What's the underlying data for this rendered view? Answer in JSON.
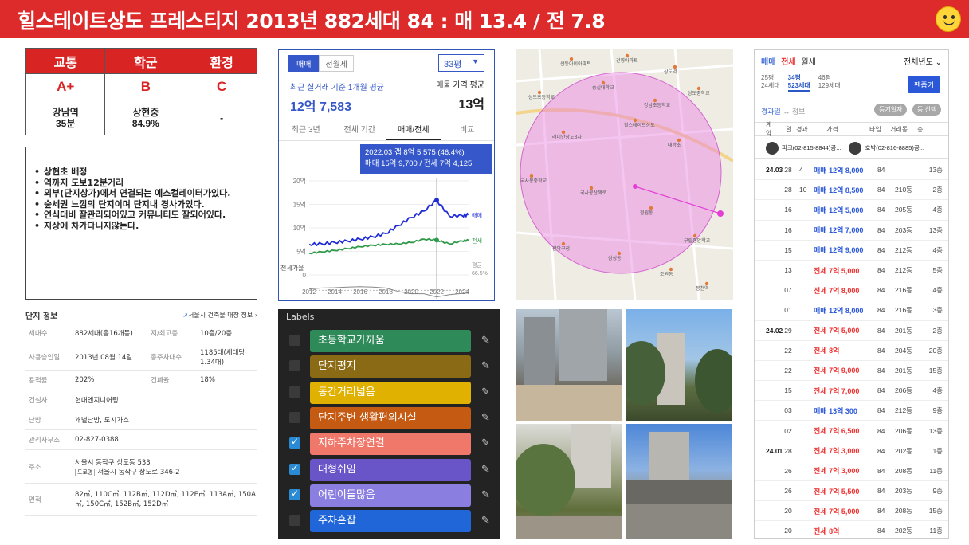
{
  "header": {
    "title": "힐스테이트상도 프레스티지  2013년 882세대  84 : 매 13.4 / 전 7.8",
    "background_color": "#dd2a2a",
    "icon": "smiley-face-icon"
  },
  "grades": {
    "headers": [
      "교통",
      "학군",
      "환경"
    ],
    "grades": [
      "A+",
      "B",
      "C"
    ],
    "details": [
      "강남역\n35분",
      "상현중\n84.9%",
      "-"
    ]
  },
  "notes": [
    "상현초 배정",
    "역까지 도보12분거리",
    "외부(단지상가)에서  연결되는 에스컬레이터가있다.",
    "숲세권 느낌의 단지이며 단지내 경사가있다.",
    "연식대비 잘관리되어있고 커뮤니티도 잘되어있다.",
    "지상에 차가다니지않는다."
  ],
  "complex_info": {
    "title": "단지 정보",
    "link": "서울시 건축물 대장 정보",
    "rows": [
      {
        "label": "세대수",
        "value": "882세대(총16개동)",
        "label2": "저/최고층",
        "value2": "10층/20층"
      },
      {
        "label": "사용승인일",
        "value": "2013년 08월 14일",
        "label2": "총주차대수",
        "value2": "1185대(세대당 1.34대)"
      },
      {
        "label": "용적률",
        "value": "202%",
        "label2": "건폐율",
        "value2": "18%"
      },
      {
        "label": "건설사",
        "value": "현대엔지니어링"
      },
      {
        "label": "난방",
        "value": "개별난방, 도시가스"
      },
      {
        "label": "관리사무소",
        "value": "02-827-0388"
      },
      {
        "label": "주소",
        "value": "서울시 동작구 상도동 533",
        "road_tag": "도로명",
        "road": "서울시 동작구 상도로 346-2"
      },
      {
        "label": "면적",
        "value": "82㎡, 110C㎡, 112B㎡, 112D㎡, 112E㎡, 113A㎡, 150A㎡, 150C㎡, 152B㎡, 152D㎡"
      }
    ]
  },
  "price_card": {
    "tab_sale": "매매",
    "tab_lease": "전월세",
    "size_select": "33평",
    "avg_label": "최근 실거래 기준 1개월 평균",
    "avg_value": "12억 7,583",
    "ask_label": "매물 가격 평균",
    "ask_value": "13억",
    "period_tabs": [
      "최근 3년",
      "전체 기간",
      "매매/전세",
      "비교"
    ],
    "tooltip_line1": "2022.03  갭 8억 5,575 (46.4%)",
    "tooltip_line2": "매매 15억 9,700 / 전세 7억 4,125",
    "lease_ratio_label": "전세가율",
    "avg_ratio_label": "평균",
    "avg_ratio_value": "66.5%",
    "series_sale": "매매",
    "series_lease": "전세"
  },
  "chart_data": {
    "type": "line",
    "x": [
      2012,
      2013,
      2014,
      2015,
      2016,
      2017,
      2018,
      2019,
      2020,
      2021,
      2022,
      2023,
      2024,
      2024.5
    ],
    "xticks": [
      "2012",
      "2014",
      "2016",
      "2018",
      "2020",
      "2022",
      "2024"
    ],
    "yticks": [
      "0",
      "5억",
      "10억",
      "15억",
      "20억"
    ],
    "ylim": [
      0,
      20
    ],
    "series": [
      {
        "name": "매매",
        "color": "#1f2bd6",
        "values": [
          6.5,
          6.6,
          6.9,
          7.2,
          7.6,
          8.1,
          8.8,
          10.5,
          12.2,
          13.6,
          15.9,
          12.5,
          12.6,
          12.8
        ]
      },
      {
        "name": "전세",
        "color": "#2e9a4a",
        "values": [
          4.6,
          4.9,
          5.2,
          5.6,
          6.0,
          6.3,
          6.5,
          6.6,
          6.9,
          7.6,
          7.4,
          6.6,
          7.2,
          7.4
        ]
      }
    ],
    "ratio_series": [
      71,
      74,
      75,
      77,
      78,
      77,
      74,
      63,
      56,
      56,
      46,
      53,
      57,
      58
    ]
  },
  "map": {
    "pois": [
      "산동아이아파트",
      "건영아파트",
      "상도역",
      "상도초등학교",
      "숭실대학교",
      "강남초등학교",
      "상도중학교",
      "래미안상도3차",
      "힐스테이트상도",
      "대방초",
      "국사봉중학교",
      "국사봉산책로",
      "정원동",
      "구립중앙학교",
      "관악구청",
      "삼성동",
      "조원동",
      "봉천역"
    ]
  },
  "labels": {
    "title": "Labels",
    "items": [
      {
        "text": "초등학교가까움",
        "color": "#2f8a5a",
        "checked": false
      },
      {
        "text": "단지평지",
        "color": "#8a6a14",
        "checked": false
      },
      {
        "text": "동간거리넓음",
        "color": "#e0b100",
        "checked": false
      },
      {
        "text": "단지주변 생활편의시설",
        "color": "#c55a12",
        "checked": false
      },
      {
        "text": "지하주차장연결",
        "color": "#f0786a",
        "checked": true
      },
      {
        "text": "대형쉬임",
        "color": "#6a55c8",
        "checked": true
      },
      {
        "text": "어린이들많음",
        "color": "#8a7ee0",
        "checked": true
      },
      {
        "text": "주차혼잡",
        "color": "#2166d8",
        "checked": false
      }
    ]
  },
  "transactions": {
    "tab_sale": "매매",
    "tab_lease": "전세",
    "tab_monthly": "월세",
    "year_select": "전체년도",
    "sizes": [
      {
        "pyeong": "25평",
        "units": "24세대"
      },
      {
        "pyeong": "34평",
        "units": "523세대"
      },
      {
        "pyeong": "46평",
        "units": "129세대"
      }
    ],
    "follow_button": "팬줍기",
    "sub_label": "경과일",
    "sub_info": "↔ 정보",
    "pill1": "등기일자",
    "pill2": "동 선택",
    "columns": [
      "계약",
      "일",
      "경과",
      "가격",
      "타입",
      "거래동",
      "층"
    ],
    "agent1": "파크(02-815-8844)공...",
    "agent2": "호박(02-816-8885)공...",
    "rows": [
      {
        "ym": "24.03",
        "day": "28",
        "elapsed": "4",
        "kind": "매매",
        "price": "12억 8,000",
        "type": "84",
        "dong": "",
        "floor": "13층"
      },
      {
        "ym": "",
        "day": "28",
        "elapsed": "10",
        "kind": "매매",
        "price": "12억 8,500",
        "type": "84",
        "dong": "210동",
        "floor": "2층"
      },
      {
        "ym": "",
        "day": "16",
        "elapsed": "",
        "kind": "매매",
        "price": "12억 5,000",
        "type": "84",
        "dong": "205동",
        "floor": "4층"
      },
      {
        "ym": "",
        "day": "16",
        "elapsed": "",
        "kind": "매매",
        "price": "12억 7,000",
        "type": "84",
        "dong": "203동",
        "floor": "13층"
      },
      {
        "ym": "",
        "day": "15",
        "elapsed": "",
        "kind": "매매",
        "price": "12억 9,000",
        "type": "84",
        "dong": "212동",
        "floor": "4층"
      },
      {
        "ym": "",
        "day": "13",
        "elapsed": "",
        "kind": "전세",
        "price": "7억 5,000",
        "type": "84",
        "dong": "212동",
        "floor": "5층"
      },
      {
        "ym": "",
        "day": "07",
        "elapsed": "",
        "kind": "전세",
        "price": "7억 8,000",
        "type": "84",
        "dong": "216동",
        "floor": "4층"
      },
      {
        "ym": "",
        "day": "01",
        "elapsed": "",
        "kind": "매매",
        "price": "12억 8,000",
        "type": "84",
        "dong": "216동",
        "floor": "3층"
      },
      {
        "ym": "24.02",
        "day": "29",
        "elapsed": "",
        "kind": "전세",
        "price": "7억 5,000",
        "type": "84",
        "dong": "201동",
        "floor": "2층"
      },
      {
        "ym": "",
        "day": "22",
        "elapsed": "",
        "kind": "전세",
        "price": "8억",
        "type": "84",
        "dong": "204동",
        "floor": "20층"
      },
      {
        "ym": "",
        "day": "22",
        "elapsed": "",
        "kind": "전세",
        "price": "7억 9,000",
        "type": "84",
        "dong": "201동",
        "floor": "15층"
      },
      {
        "ym": "",
        "day": "15",
        "elapsed": "",
        "kind": "전세",
        "price": "7억 7,000",
        "type": "84",
        "dong": "206동",
        "floor": "4층"
      },
      {
        "ym": "",
        "day": "03",
        "elapsed": "",
        "kind": "매매",
        "price": "13억 300",
        "type": "84",
        "dong": "212동",
        "floor": "9층"
      },
      {
        "ym": "",
        "day": "02",
        "elapsed": "",
        "kind": "전세",
        "price": "7억 6,500",
        "type": "84",
        "dong": "206동",
        "floor": "13층"
      },
      {
        "ym": "24.01",
        "day": "28",
        "elapsed": "",
        "kind": "전세",
        "price": "7억 3,000",
        "type": "84",
        "dong": "202동",
        "floor": "1층"
      },
      {
        "ym": "",
        "day": "26",
        "elapsed": "",
        "kind": "전세",
        "price": "7억 3,000",
        "type": "84",
        "dong": "208동",
        "floor": "11층"
      },
      {
        "ym": "",
        "day": "26",
        "elapsed": "",
        "kind": "전세",
        "price": "7억 5,500",
        "type": "84",
        "dong": "203동",
        "floor": "9층"
      },
      {
        "ym": "",
        "day": "20",
        "elapsed": "",
        "kind": "전세",
        "price": "7억 5,000",
        "type": "84",
        "dong": "208동",
        "floor": "15층"
      },
      {
        "ym": "",
        "day": "20",
        "elapsed": "",
        "kind": "전세",
        "price": "8억",
        "type": "84",
        "dong": "202동",
        "floor": "11층"
      }
    ]
  }
}
